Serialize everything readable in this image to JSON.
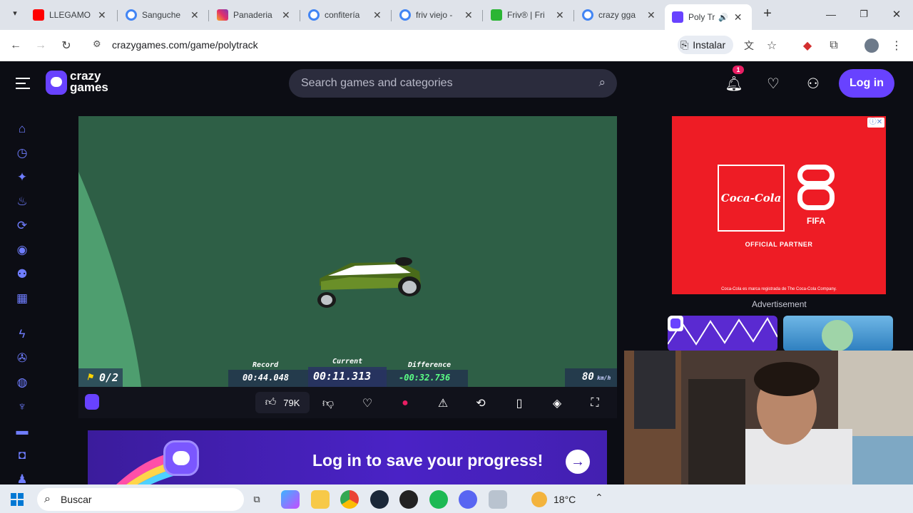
{
  "browser": {
    "tabs": [
      {
        "title": "LLEGAMO",
        "fav_color": "#ff0000"
      },
      {
        "title": "Sanguche",
        "fav_color": "#4285f4"
      },
      {
        "title": "Panaderia",
        "fav_color": "#e1306c"
      },
      {
        "title": "confitería",
        "fav_color": "#4285f4"
      },
      {
        "title": "friv viejo -",
        "fav_color": "#4285f4"
      },
      {
        "title": "Friv® | Fri",
        "fav_color": "#2bb534"
      },
      {
        "title": "crazy gga",
        "fav_color": "#4285f4"
      },
      {
        "title": "Poly Tra",
        "fav_color": "#6842ff"
      }
    ],
    "close_glyph": "✕",
    "new_tab_glyph": "+",
    "url": "crazygames.com/game/polytrack",
    "install_label": "Instalar"
  },
  "site": {
    "logo_line1": "crazy",
    "logo_line2": "games",
    "search_placeholder": "Search games and categories",
    "notification_count": "1",
    "login_label": "Log in"
  },
  "game": {
    "checkpoints": "0/2",
    "record_label": "Record",
    "record_time": "00:44.048",
    "current_label": "Current",
    "current_time": "00:11.313",
    "difference_label": "Difference",
    "difference_time": "-00:32.736",
    "speed": "80",
    "speed_unit": "km/h",
    "likes": "79K"
  },
  "banner": {
    "text": "Log in to save your progress!"
  },
  "ad": {
    "brand": "Coca-Cola",
    "partner": "FIFA",
    "official": "OFFICIAL PARTNER",
    "disclaimer": "Coca-Cola es marca registrada de The Coca-Cola Company.",
    "label": "Advertisement"
  },
  "taskbar": {
    "search_label": "Buscar",
    "weather": "18°C"
  },
  "colors": {
    "accent": "#6842ff",
    "game_bg": "#2e5f46",
    "ad_red": "#ee1c25"
  }
}
